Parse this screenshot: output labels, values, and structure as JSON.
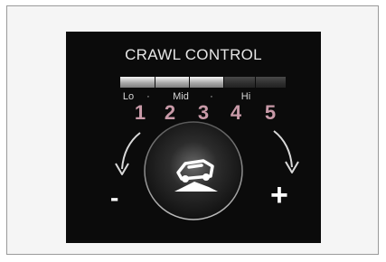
{
  "display": {
    "title": "CRAWL CONTROL",
    "scale_labels": [
      "Lo",
      "·",
      "Mid",
      "·",
      "Hi"
    ],
    "step_numbers": [
      "1",
      "2",
      "3",
      "4",
      "5"
    ],
    "segments_total": 5,
    "segments_lit": 3,
    "decrease_symbol": "-",
    "increase_symbol": "+"
  },
  "colors": {
    "background": "#0b0b0b",
    "step_number": "#c89aa8",
    "text": "#e6e6e6"
  }
}
